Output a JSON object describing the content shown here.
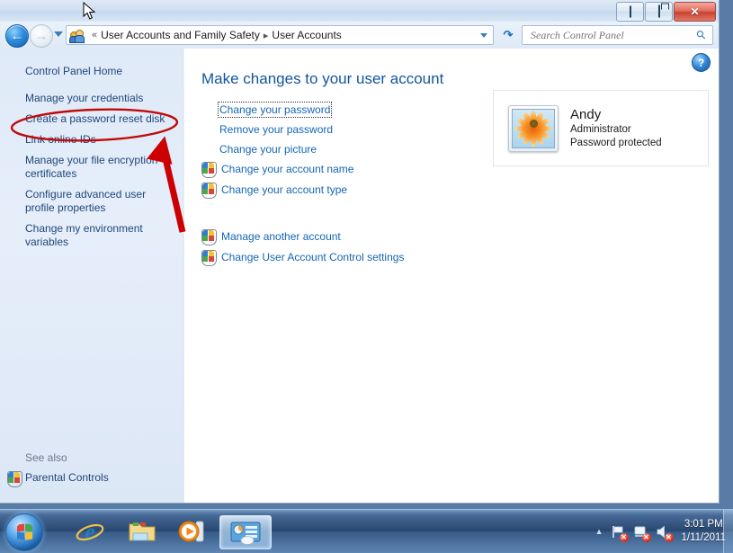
{
  "window": {
    "controls": {
      "minimize": "Minimize",
      "restore": "Restore",
      "close": "Close"
    }
  },
  "navbar": {
    "back_label": "Back",
    "forward_label": "Forward",
    "history_label": "Recent pages",
    "refresh_label": "Refresh",
    "breadcrumb": {
      "separator_leading": "«",
      "separator": "▸",
      "items": [
        "User Accounts and Family Safety",
        "User Accounts"
      ]
    },
    "search": {
      "placeholder": "Search Control Panel",
      "value": ""
    }
  },
  "sidebar": {
    "home_label": "Control Panel Home",
    "items": [
      "Manage your credentials",
      "Create a password reset disk",
      "Link online IDs",
      "Manage your file encryption certificates",
      "Configure advanced user profile properties",
      "Change my environment variables"
    ],
    "see_also_label": "See also",
    "see_also_items": [
      "Parental Controls"
    ]
  },
  "content": {
    "help_label": "?",
    "title": "Make changes to your user account",
    "links": [
      {
        "label": "Change your password",
        "shield": false,
        "focused": true
      },
      {
        "label": "Remove your password",
        "shield": false,
        "focused": false
      },
      {
        "label": "Change your picture",
        "shield": false,
        "focused": false
      },
      {
        "label": "Change your account name",
        "shield": true,
        "focused": false
      },
      {
        "label": "Change your account type",
        "shield": true,
        "focused": false
      },
      {
        "label": "Manage another account",
        "shield": true,
        "focused": false
      },
      {
        "label": "Change User Account Control settings",
        "shield": true,
        "focused": false
      }
    ],
    "account": {
      "name": "Andy",
      "role": "Administrator",
      "password_status": "Password protected",
      "avatar_name": "daisy-flower-avatar"
    }
  },
  "annotations": {
    "ellipse_target": "Create a password reset disk",
    "ellipse_color": "#c00a0a",
    "arrow_color": "#cc0000"
  },
  "taskbar": {
    "start_label": "Start",
    "buttons": [
      {
        "name": "internet-explorer",
        "label": "Internet Explorer",
        "active": false
      },
      {
        "name": "windows-explorer",
        "label": "Windows Explorer",
        "active": false
      },
      {
        "name": "windows-media-player",
        "label": "Windows Media Player",
        "active": false
      },
      {
        "name": "control-panel",
        "label": "User Accounts",
        "active": true
      }
    ],
    "tray": {
      "overflow_label": "Show hidden icons",
      "icons": [
        "action-center-flag-icon",
        "network-icon",
        "volume-icon"
      ],
      "time": "3:01 PM",
      "date": "1/11/2011"
    }
  },
  "colors": {
    "accent_link": "#1366b5",
    "sidebar_link": "#20477a",
    "title_blue": "#12559c",
    "annotation_red": "#c00a0a"
  }
}
